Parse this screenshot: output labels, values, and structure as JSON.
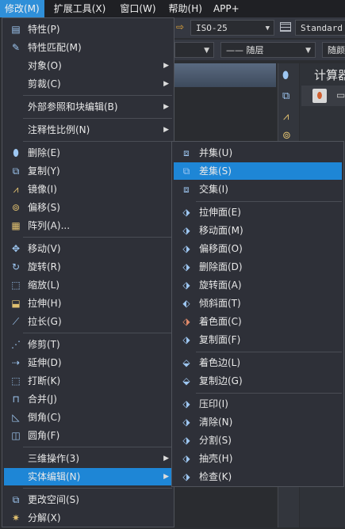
{
  "menubar": {
    "items": [
      "修改(M)",
      "扩展工具(X)",
      "窗口(W)",
      "帮助(H)",
      "APP+"
    ]
  },
  "background": {
    "textstyle_value": "ISO-25",
    "tablestyle_value": "Standard",
    "linetype_value": "—— 随层",
    "lineweight_partial": "随颜",
    "panel_title": "计算器"
  },
  "main_menu": {
    "items": {
      "properties": "特性(P)",
      "match_properties": "特性匹配(M)",
      "object": "对象(O)",
      "clip": "剪裁(C)",
      "xref_block_edit": "外部参照和块编辑(B)",
      "annotative_scale": "注释性比例(N)",
      "erase": "删除(E)",
      "copy": "复制(Y)",
      "mirror": "镜像(I)",
      "offset": "偏移(S)",
      "array": "阵列(A)...",
      "move": "移动(V)",
      "rotate": "旋转(R)",
      "scale": "缩放(L)",
      "stretch": "拉伸(H)",
      "lengthen": "拉长(G)",
      "trim": "修剪(T)",
      "extend": "延伸(D)",
      "break": "打断(K)",
      "join": "合并(J)",
      "chamfer": "倒角(C)",
      "fillet": "圆角(F)",
      "3d_operations": "三维操作(3)",
      "solid_editing": "实体编辑(N)",
      "change_space": "更改空间(S)",
      "explode": "分解(X)"
    }
  },
  "sub_menu": {
    "items": {
      "union": "并集(U)",
      "subtract": "差集(S)",
      "intersect": "交集(I)",
      "extrude_faces": "拉伸面(E)",
      "move_faces": "移动面(M)",
      "offset_faces": "偏移面(O)",
      "delete_faces": "删除面(D)",
      "rotate_faces": "旋转面(A)",
      "taper_faces": "倾斜面(T)",
      "color_faces": "着色面(C)",
      "copy_faces": "复制面(F)",
      "color_edges": "着色边(L)",
      "copy_edges": "复制边(G)",
      "imprint": "压印(I)",
      "clean": "清除(N)",
      "separate": "分割(S)",
      "shell": "抽壳(H)",
      "check": "检查(K)"
    }
  },
  "colors": {
    "highlight": "#1e86d6",
    "menu_bg": "#2e3038",
    "menubar_active": "#2f8fd8"
  }
}
